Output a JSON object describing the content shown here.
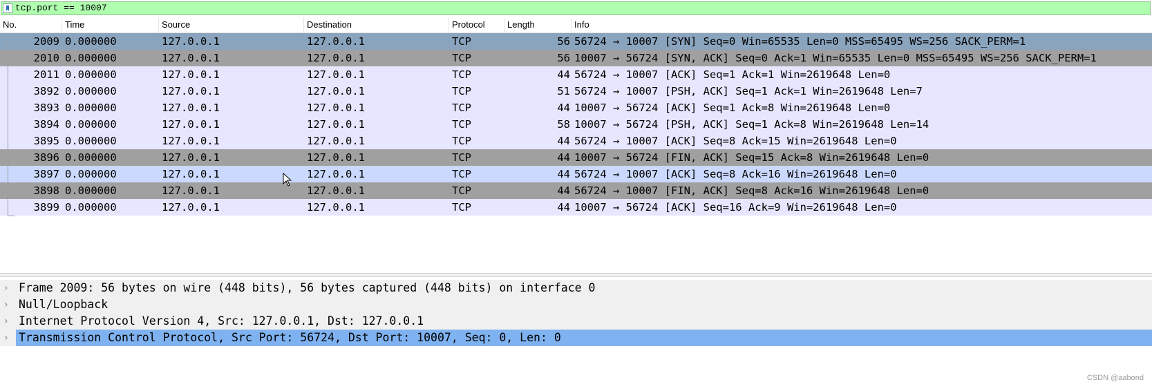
{
  "filter": {
    "value": "tcp.port == 10007"
  },
  "columns": [
    "No.",
    "Time",
    "Source",
    "Destination",
    "Protocol",
    "Length",
    "Info"
  ],
  "packets": [
    {
      "no": "2009",
      "time": "0.000000",
      "src": "127.0.0.1",
      "dst": "127.0.0.1",
      "proto": "TCP",
      "len": "56",
      "info": "56724 → 10007 [SYN] Seq=0 Win=65535 Len=0 MSS=65495 WS=256 SACK_PERM=1"
    },
    {
      "no": "2010",
      "time": "0.000000",
      "src": "127.0.0.1",
      "dst": "127.0.0.1",
      "proto": "TCP",
      "len": "56",
      "info": "10007 → 56724 [SYN, ACK] Seq=0 Ack=1 Win=65535 Len=0 MSS=65495 WS=256 SACK_PERM=1"
    },
    {
      "no": "2011",
      "time": "0.000000",
      "src": "127.0.0.1",
      "dst": "127.0.0.1",
      "proto": "TCP",
      "len": "44",
      "info": "56724 → 10007 [ACK] Seq=1 Ack=1 Win=2619648 Len=0"
    },
    {
      "no": "3892",
      "time": "0.000000",
      "src": "127.0.0.1",
      "dst": "127.0.0.1",
      "proto": "TCP",
      "len": "51",
      "info": "56724 → 10007 [PSH, ACK] Seq=1 Ack=1 Win=2619648 Len=7"
    },
    {
      "no": "3893",
      "time": "0.000000",
      "src": "127.0.0.1",
      "dst": "127.0.0.1",
      "proto": "TCP",
      "len": "44",
      "info": "10007 → 56724 [ACK] Seq=1 Ack=8 Win=2619648 Len=0"
    },
    {
      "no": "3894",
      "time": "0.000000",
      "src": "127.0.0.1",
      "dst": "127.0.0.1",
      "proto": "TCP",
      "len": "58",
      "info": "10007 → 56724 [PSH, ACK] Seq=1 Ack=8 Win=2619648 Len=14"
    },
    {
      "no": "3895",
      "time": "0.000000",
      "src": "127.0.0.1",
      "dst": "127.0.0.1",
      "proto": "TCP",
      "len": "44",
      "info": "56724 → 10007 [ACK] Seq=8 Ack=15 Win=2619648 Len=0"
    },
    {
      "no": "3896",
      "time": "0.000000",
      "src": "127.0.0.1",
      "dst": "127.0.0.1",
      "proto": "TCP",
      "len": "44",
      "info": "10007 → 56724 [FIN, ACK] Seq=15 Ack=8 Win=2619648 Len=0"
    },
    {
      "no": "3897",
      "time": "0.000000",
      "src": "127.0.0.1",
      "dst": "127.0.0.1",
      "proto": "TCP",
      "len": "44",
      "info": "56724 → 10007 [ACK] Seq=8 Ack=16 Win=2619648 Len=0"
    },
    {
      "no": "3898",
      "time": "0.000000",
      "src": "127.0.0.1",
      "dst": "127.0.0.1",
      "proto": "TCP",
      "len": "44",
      "info": "56724 → 10007 [FIN, ACK] Seq=8 Ack=16 Win=2619648 Len=0"
    },
    {
      "no": "3899",
      "time": "0.000000",
      "src": "127.0.0.1",
      "dst": "127.0.0.1",
      "proto": "TCP",
      "len": "44",
      "info": "10007 → 56724 [ACK] Seq=16 Ack=9 Win=2619648 Len=0"
    }
  ],
  "details": [
    {
      "text": "Frame 2009: 56 bytes on wire (448 bits), 56 bytes captured (448 bits) on interface 0"
    },
    {
      "text": "Null/Loopback"
    },
    {
      "text": "Internet Protocol Version 4, Src: 127.0.0.1, Dst: 127.0.0.1"
    },
    {
      "text": "Transmission Control Protocol, Src Port: 56724, Dst Port: 10007, Seq: 0, Len: 0"
    }
  ],
  "colors": {
    "filter_bg": "#afffaf",
    "row_selected": "#8aa4be",
    "row_gray": "#a0a0a0",
    "row_tcp": "#e7e6ff",
    "row_hover": "#cbd9ff",
    "detail_selected": "#7fb2f0"
  },
  "watermark": "CSDN @aabond"
}
